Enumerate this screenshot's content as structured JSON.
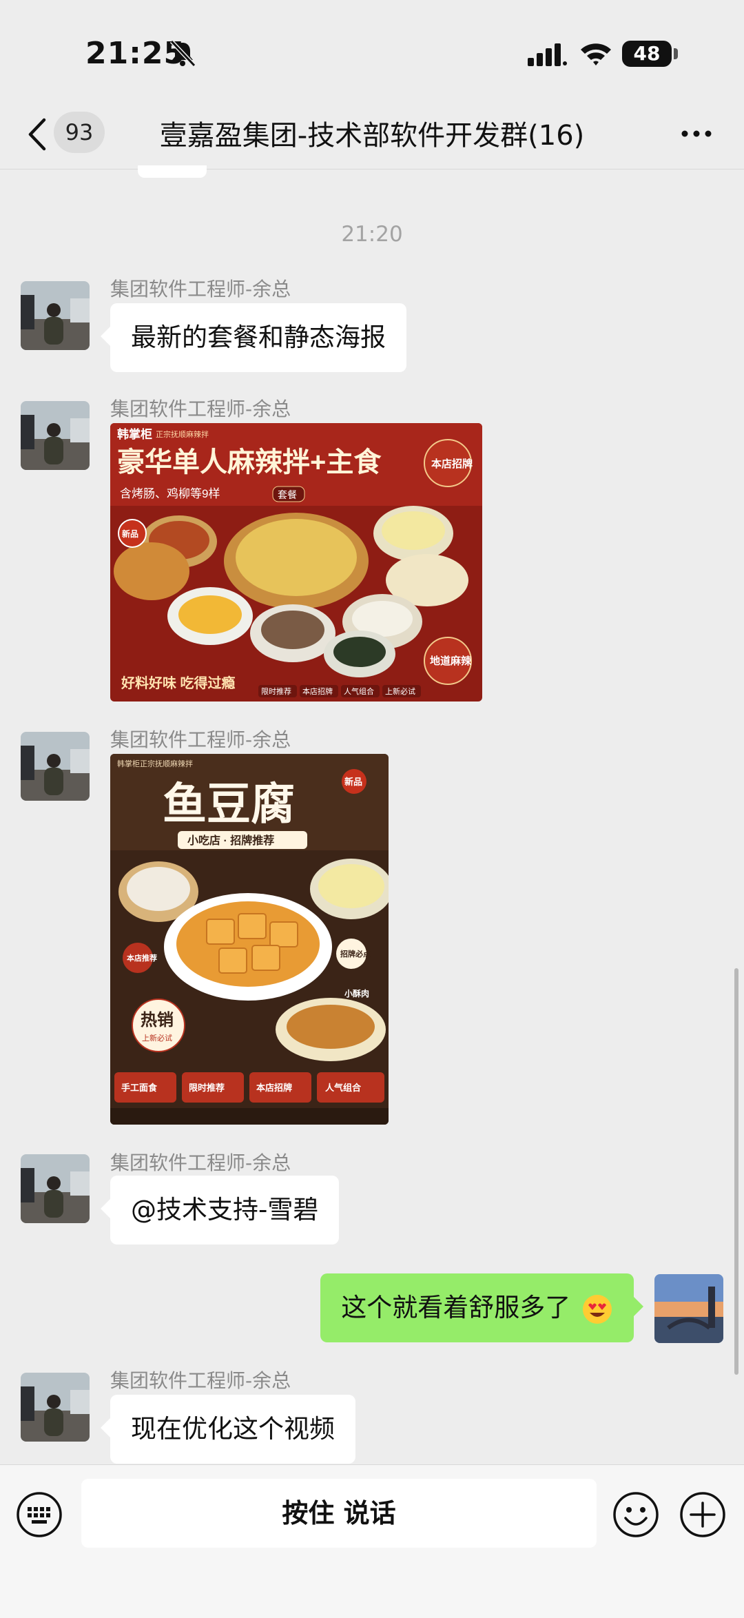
{
  "status_bar": {
    "time": "21:25",
    "battery": "48",
    "icons": [
      "bell-muted-icon",
      "signal-icon",
      "wifi-icon",
      "battery-icon"
    ]
  },
  "nav": {
    "unread_count": "93",
    "title": "壹嘉盈集团-技术部软件开发群(16)",
    "icons": [
      "back-icon",
      "more-icon"
    ]
  },
  "chat": {
    "timestamp": "21:20",
    "messages": [
      {
        "sender": "集团软件工程师-余总",
        "text": "最新的套餐和静态海报"
      },
      {
        "sender": "集团软件工程师-余总"
      },
      {
        "sender": "集团软件工程师-余总"
      },
      {
        "sender": "集团软件工程师-余总",
        "text": "@技术支持-雪碧"
      },
      {
        "text": "这个就看着舒服多了"
      },
      {
        "sender": "集团软件工程师-余总",
        "text": "现在优化这个视频"
      }
    ],
    "poster1": {
      "brand": "韩掌柜",
      "tagline": "正宗抚顺麻辣拌",
      "headline": "豪华单人麻辣拌+主食",
      "sub": "含烤肠、鸡柳等9样",
      "tag": "套餐",
      "seal": "本店招牌",
      "new_badge": "新品",
      "bottom": "好料好味 吃得过瘾",
      "corner": "地道麻辣",
      "chips": [
        "限时推荐",
        "本店招牌",
        "人气组合",
        "上新必试"
      ]
    },
    "poster2": {
      "small_top": "韩掌柜正宗抚顺麻辣拌",
      "headline": "鱼豆腐",
      "new_badge": "新品",
      "sub": "小吃店 · 招牌推荐",
      "hot": "热销",
      "hot_sub": "上新必试",
      "recommend": "本店推荐",
      "must_try": "招牌必点",
      "crispy": "小酥肉",
      "buttons": [
        "手工面食",
        "限时推荐",
        "本店招牌",
        "人气组合"
      ]
    }
  },
  "input_bar": {
    "talk_label": "按住 说话",
    "icons": [
      "keyboard-icon",
      "emoji-icon",
      "plus-icon"
    ]
  },
  "colors": {
    "background": "#ededed",
    "my_bubble": "#95ec69",
    "their_bubble": "#ffffff",
    "poster_red": "#a8261b"
  }
}
